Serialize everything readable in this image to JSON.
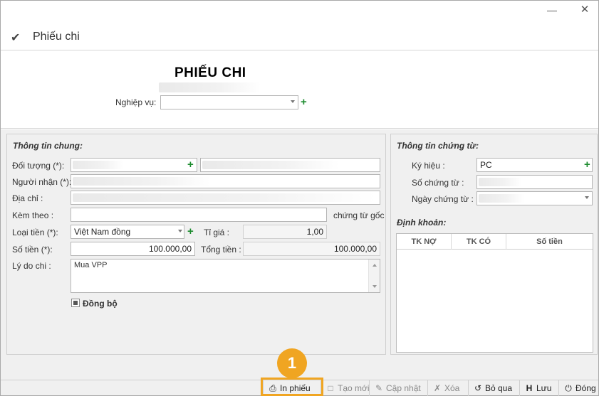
{
  "window": {
    "minimize_icon": "minimize-icon",
    "close_icon": "close-icon",
    "title": "Phiếu chi"
  },
  "header": {
    "main_title": "PHIẾU CHI",
    "nghiep_vu_label": "Nghiệp vụ:",
    "nghiep_vu_value": ""
  },
  "thong_tin_chung": {
    "title": "Thông tin chung:",
    "doi_tuong_label": "Đối tượng (*):",
    "nguoi_nhan_label": "Người nhận (*):",
    "dia_chi_label": "Địa chỉ :",
    "kem_theo_label": "Kèm theo :",
    "kem_theo_value": "",
    "chung_tu_goc_label": "chứng từ gốc",
    "loai_tien_label": "Loại tiền (*):",
    "loai_tien_value": "Việt Nam đồng",
    "ti_gia_label": "Tỉ giá :",
    "ti_gia_value": "1,00",
    "so_tien_label": "Số tiền (*):",
    "so_tien_value": "100.000,00",
    "tong_tien_label": "Tổng tiền :",
    "tong_tien_value": "100.000,00",
    "ly_do_chi_label": "Lý do chi :",
    "ly_do_chi_value": "Mua VPP",
    "dong_bo_label": "Đồng bộ",
    "dong_bo_checked": true
  },
  "thong_tin_chung_tu": {
    "title": "Thông tin chứng từ:",
    "ky_hieu_label": "Ký hiệu :",
    "ky_hieu_value": "PC",
    "so_chung_tu_label": "Số chứng từ :",
    "ngay_chung_tu_label": "Ngày chứng từ :"
  },
  "dinh_khoan": {
    "title": "Định khoản:",
    "columns": [
      "TK NỢ",
      "TK CÓ",
      "Số tiền"
    ],
    "rows": []
  },
  "toolbar": {
    "in_phieu": "In phiếu",
    "tao_moi": "Tạo mới",
    "cap_nhat": "Cập nhật",
    "xoa": "Xóa",
    "bo_qua": "Bỏ qua",
    "luu": "Lưu",
    "dong": "Đóng"
  },
  "annotation": {
    "badge_number": "1",
    "accent_color": "#f0a522"
  }
}
